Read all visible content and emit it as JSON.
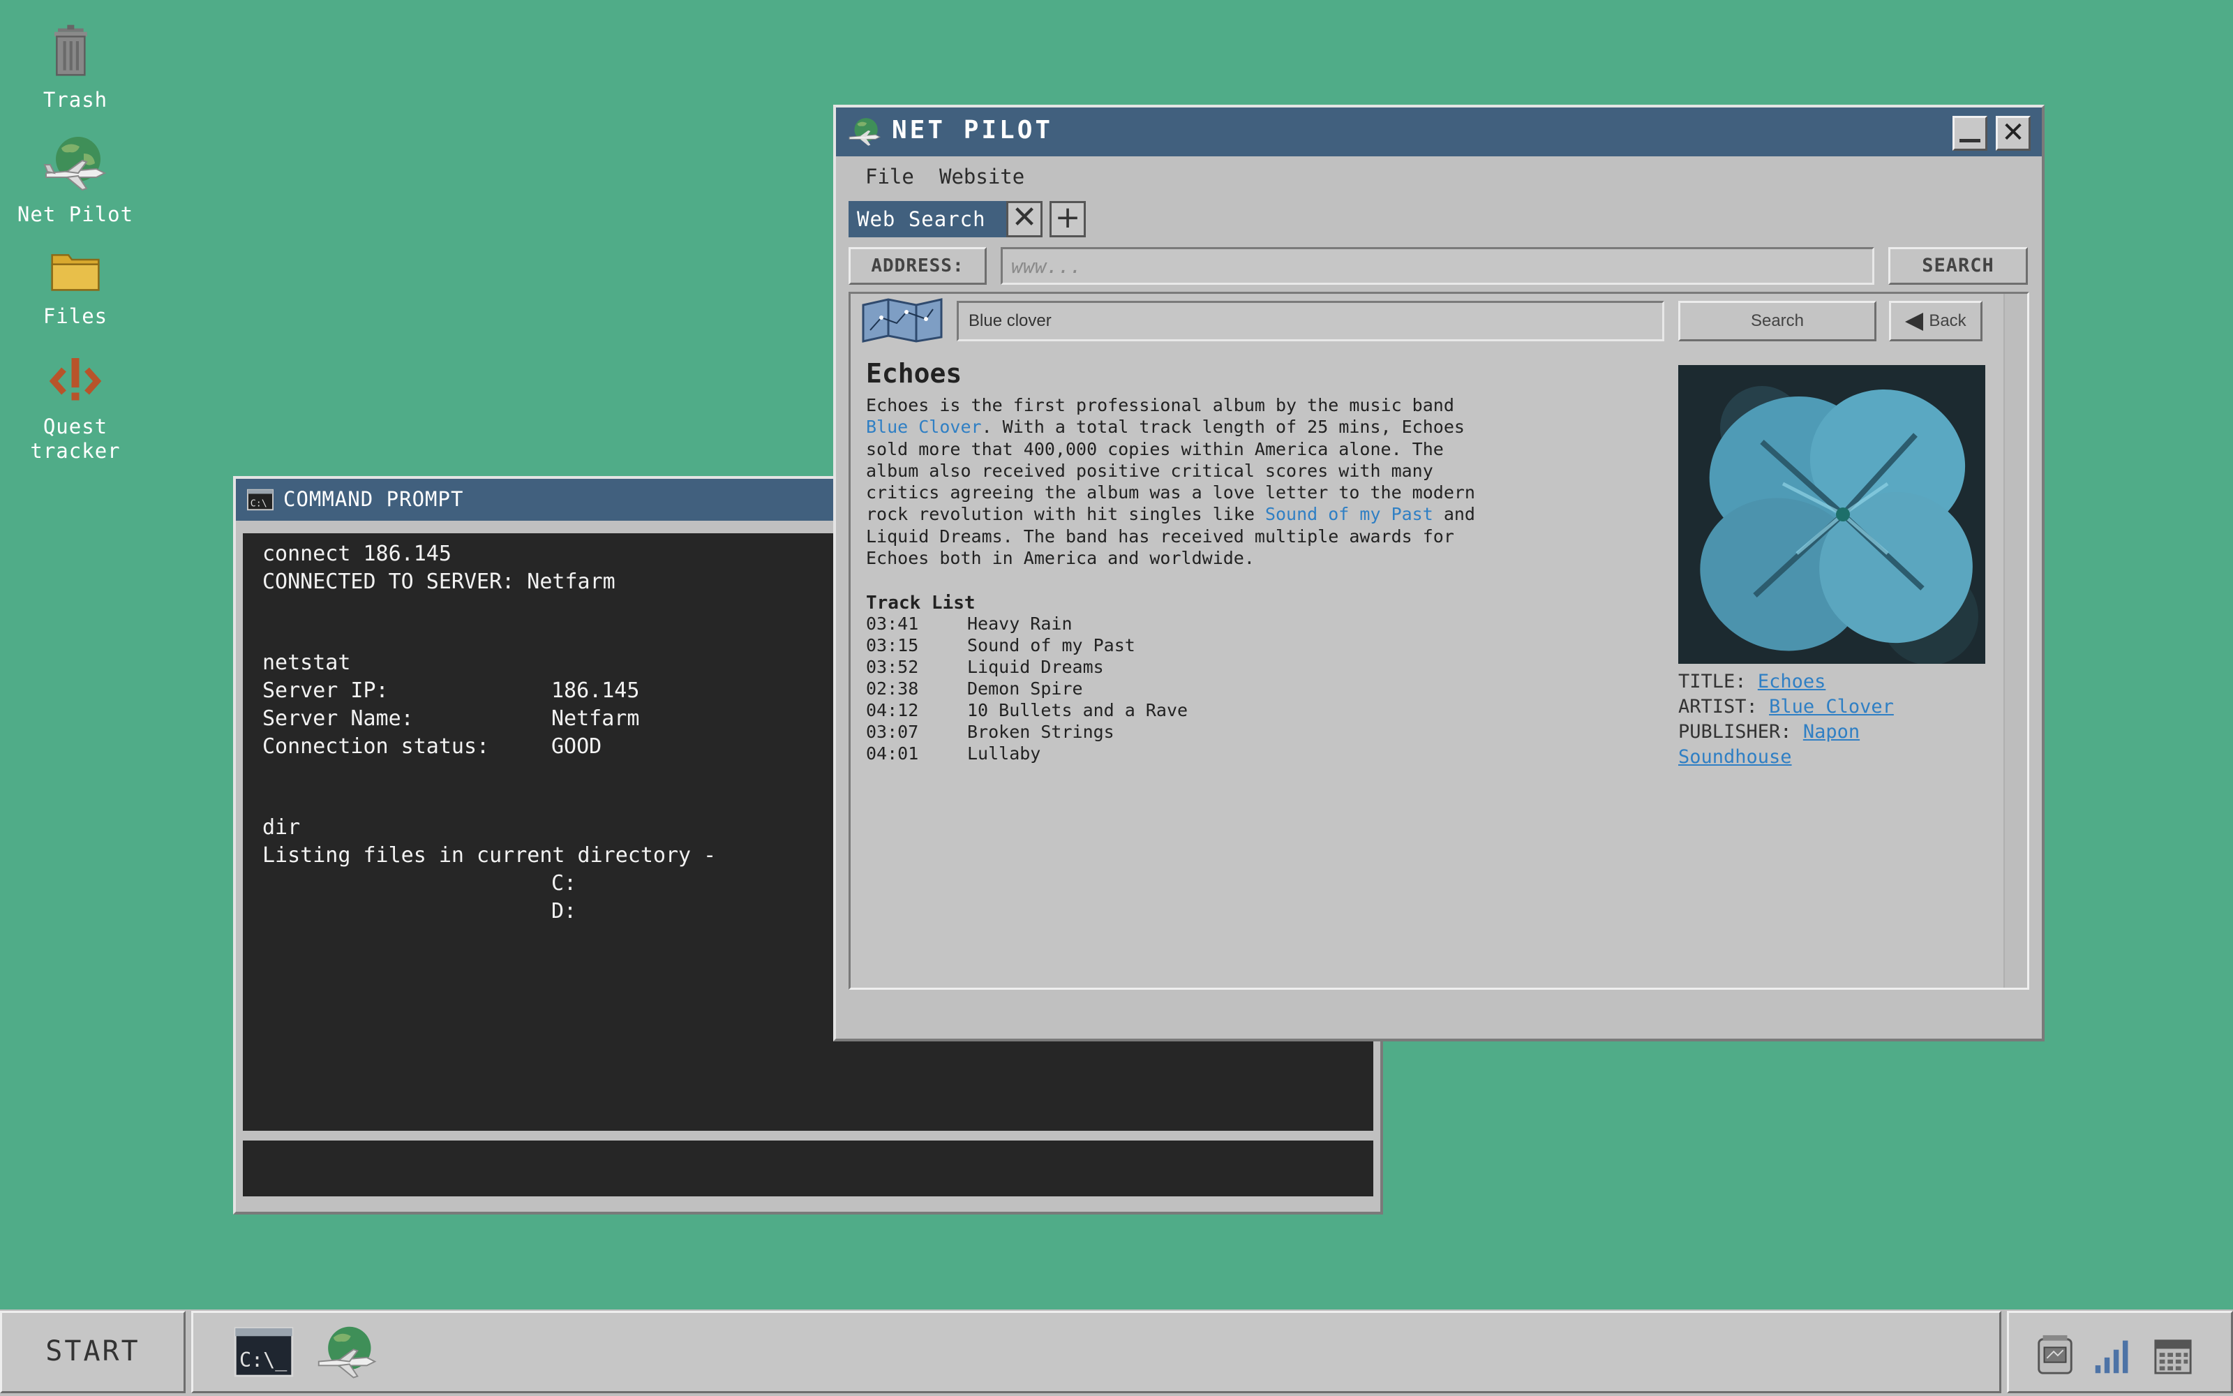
{
  "desktop": {
    "icons": [
      {
        "label": "Trash",
        "icon": "trash-can-icon"
      },
      {
        "label": "Net Pilot",
        "icon": "net-pilot-globe-icon"
      },
      {
        "label": "Files",
        "icon": "folder-icon"
      },
      {
        "label": "Quest\ntracker",
        "icon": "quest-tracker-icon"
      }
    ]
  },
  "command_prompt": {
    "title": "COMMAND PROMPT",
    "lines": {
      "l1": "connect 186.145",
      "l2": "CONNECTED TO SERVER: Netfarm",
      "l3": "netstat",
      "l4k": "Server IP:",
      "l4v": "186.145",
      "l5k": "Server Name:",
      "l5v": "Netfarm",
      "l6k": "Connection status:",
      "l6v": "GOOD",
      "l7": "dir",
      "l8": "Listing files in current directory -",
      "l9": "C:",
      "l10": "D:"
    }
  },
  "net_pilot": {
    "title": "NET PILOT",
    "menu": {
      "file": "File",
      "website": "Website"
    },
    "tab_label": "Web Search",
    "address_label": "ADDRESS:",
    "address_placeholder": "www...",
    "search_label": "SEARCH",
    "page": {
      "search_value": "Blue clover",
      "search_button": "Search",
      "back_button": "Back",
      "title": "Echoes",
      "para": {
        "p1": "Echoes is the first professional album by the music band ",
        "link1": "Blue Clover",
        "p2": ". With a total track length of 25 mins, Echoes sold more that 400,000 copies within America alone. The album also received positive critical scores with many critics agreeing the album was a love letter to the modern rock revolution with hit singles like ",
        "link2": "Sound of my Past",
        "p3": " and Liquid Dreams. The band has received multiple awards for Echoes both in America and worldwide."
      },
      "track_list_header": "Track List",
      "tracks": [
        {
          "time": "03:41",
          "name": "Heavy Rain"
        },
        {
          "time": "03:15",
          "name": "Sound of my Past"
        },
        {
          "time": "03:52",
          "name": "Liquid Dreams"
        },
        {
          "time": "02:38",
          "name": "Demon Spire"
        },
        {
          "time": "04:12",
          "name": "10 Bullets and a Rave"
        },
        {
          "time": "03:07",
          "name": "Broken Strings"
        },
        {
          "time": "04:01",
          "name": "Lullaby"
        }
      ],
      "meta": {
        "title_label": "TITLE:",
        "title_value": "Echoes",
        "artist_label": "ARTIST:",
        "artist_value": "Blue Clover",
        "publisher_label": "PUBLISHER:",
        "publisher_value": "Napon Soundhouse"
      }
    }
  },
  "taskbar": {
    "start_label": "START",
    "apps": [
      "command-prompt-icon",
      "net-pilot-globe-icon"
    ],
    "tray": [
      "network-device-icon",
      "signal-bars-icon",
      "calendar-icon"
    ]
  },
  "colors": {
    "desktop": "#50ac88",
    "titlebar": "#41607e",
    "link": "#2f7fc4",
    "console": "#262626"
  }
}
